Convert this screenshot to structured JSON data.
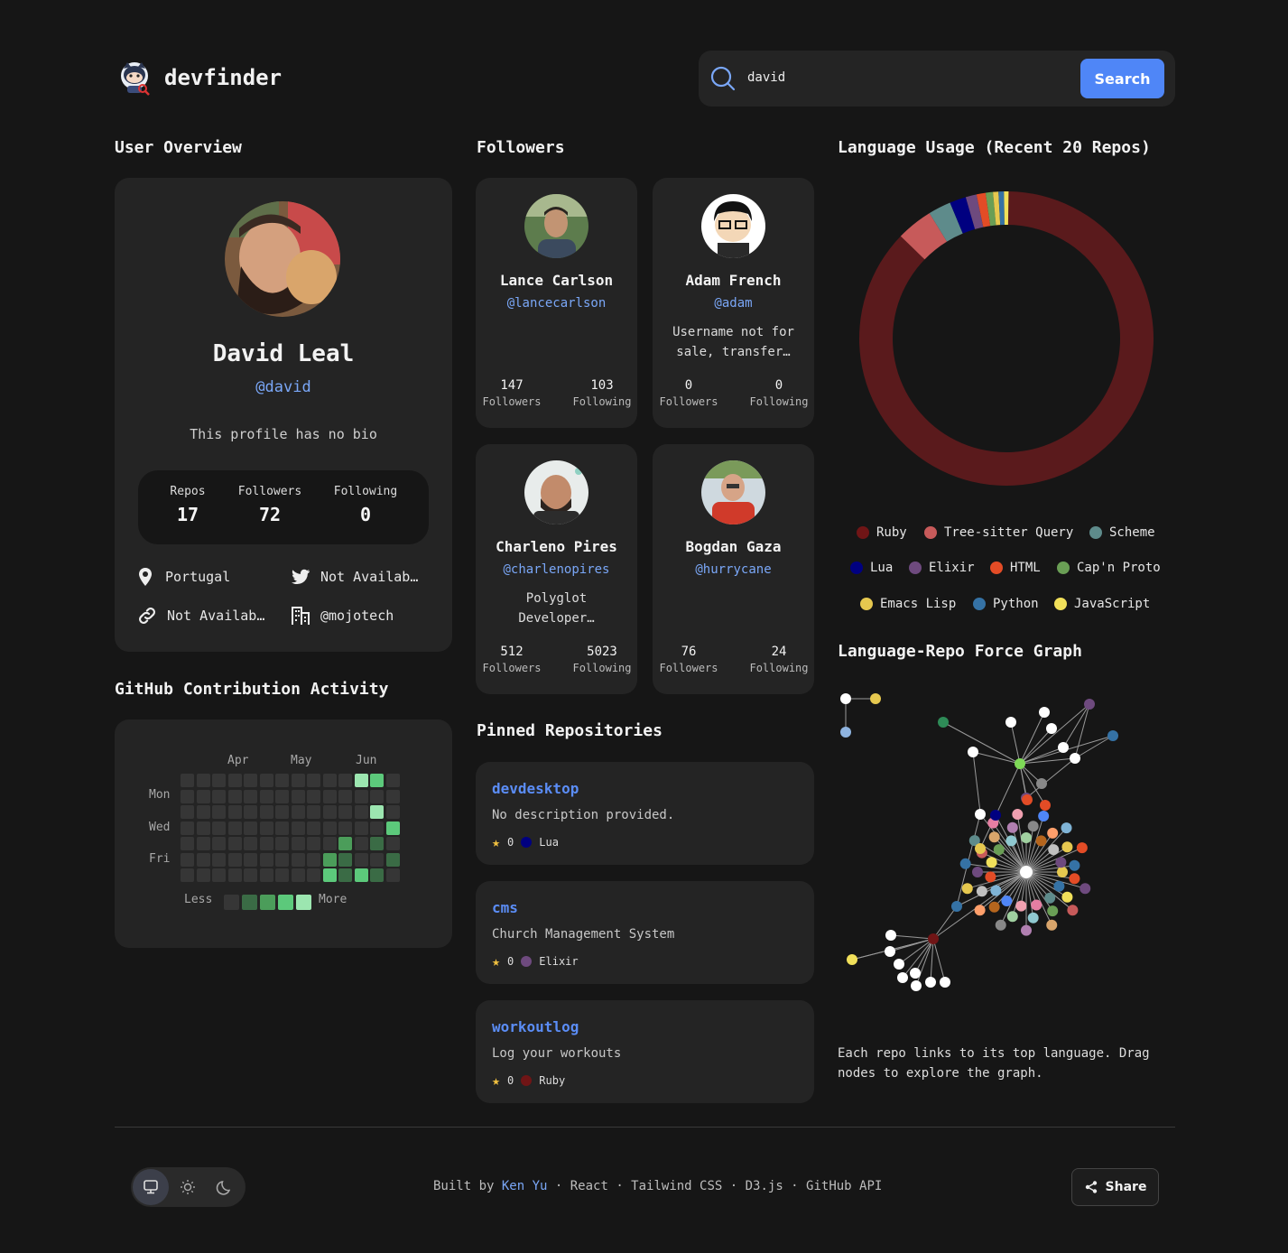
{
  "app": {
    "name": "devfinder"
  },
  "search": {
    "value": "david",
    "button_label": "Search"
  },
  "sections": {
    "overview": "User Overview",
    "followers": "Followers",
    "language": "Language Usage (Recent 20 Repos)",
    "contrib": "GitHub Contribution Activity",
    "pinned": "Pinned Repositories",
    "graph": "Language-Repo Force Graph"
  },
  "user": {
    "name": "David Leal",
    "handle": "@david",
    "bio": "This profile has no bio",
    "stats": {
      "repos_label": "Repos",
      "repos": "17",
      "followers_label": "Followers",
      "followers": "72",
      "following_label": "Following",
      "following": "0"
    },
    "location": "Portugal",
    "twitter": "Not Availab…",
    "blog": "Not Availab…",
    "company": "@mojotech"
  },
  "contrib": {
    "months": [
      "Apr",
      "May",
      "Jun"
    ],
    "days": [
      "Mon",
      "Wed",
      "Fri"
    ],
    "less": "Less",
    "more": "More",
    "colors": [
      "#363636",
      "#3a6b45",
      "#4b9d5a",
      "#5cc97b",
      "#9ce6b0"
    ]
  },
  "followers": [
    {
      "name": "Lance Carlson",
      "handle": "@lancecarlson",
      "bio": "",
      "followers": "147",
      "following": "103",
      "followers_label": "Followers",
      "following_label": "Following"
    },
    {
      "name": "Adam French",
      "handle": "@adam",
      "bio": "Username not for sale, transfer…",
      "followers": "0",
      "following": "0",
      "followers_label": "Followers",
      "following_label": "Following"
    },
    {
      "name": "Charleno Pires",
      "handle": "@charlenopires",
      "bio": "Polyglot Developer…",
      "followers": "512",
      "following": "5023",
      "followers_label": "Followers",
      "following_label": "Following"
    },
    {
      "name": "Bogdan Gaza",
      "handle": "@hurrycane",
      "bio": "",
      "followers": "76",
      "following": "24",
      "followers_label": "Followers",
      "following_label": "Following"
    }
  ],
  "repos": [
    {
      "name": "devdesktop",
      "desc": "No description provided.",
      "stars": "0",
      "lang": "Lua",
      "color": "#000080"
    },
    {
      "name": "cms",
      "desc": "Church Management System",
      "stars": "0",
      "lang": "Elixir",
      "color": "#6e4a7e"
    },
    {
      "name": "workoutlog",
      "desc": "Log your workouts",
      "stars": "0",
      "lang": "Ruby",
      "color": "#701516"
    }
  ],
  "chart_data": {
    "type": "pie",
    "title": "Language Usage (Recent 20 Repos)",
    "categories": [
      "Ruby",
      "Tree-sitter Query",
      "Scheme",
      "Lua",
      "Elixir",
      "HTML",
      "Cap'n Proto",
      "Emacs Lisp",
      "Python",
      "JavaScript"
    ],
    "values": [
      87.0,
      4.0,
      2.5,
      1.8,
      1.2,
      1.0,
      0.8,
      0.6,
      0.6,
      0.5
    ],
    "colors": [
      "#701516",
      "#c75a5a",
      "#5e8b8b",
      "#000080",
      "#6e4a7e",
      "#e34c26",
      "#6a9e55",
      "#e6c84f",
      "#3572a5",
      "#f1e05a"
    ],
    "legend_placement": "bottom"
  },
  "graph": {
    "note": "Each repo links to its top language. Drag nodes to explore the graph."
  },
  "footer": {
    "built_by": "Built by",
    "author": "Ken Yu",
    "tech": "· React · Tailwind CSS · D3.js · GitHub API",
    "share": "Share"
  }
}
